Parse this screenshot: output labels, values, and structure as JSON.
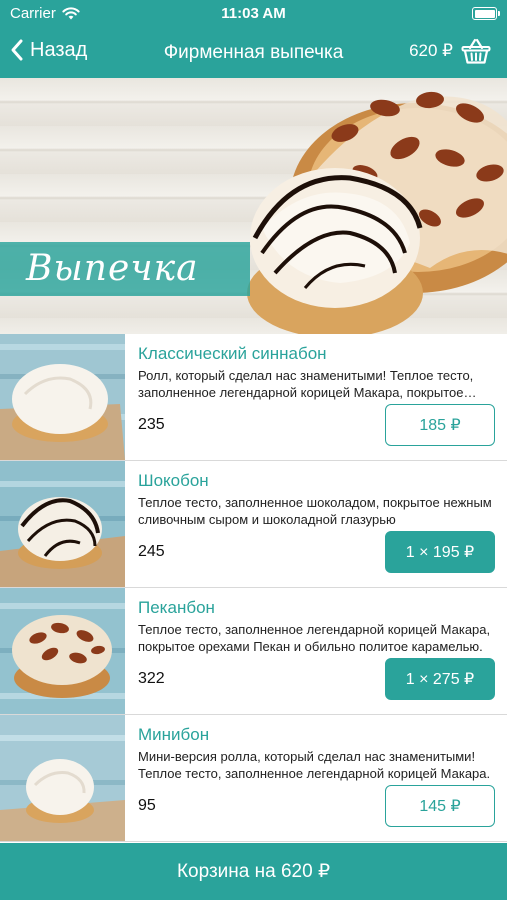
{
  "status_bar": {
    "carrier": "Carrier",
    "time": "11:03 AM"
  },
  "nav": {
    "back_label": "Назад",
    "title": "Фирменная выпечка",
    "cart_total": "620 ₽"
  },
  "banner": {
    "label": "Выпечка"
  },
  "products": [
    {
      "name": "Классический синнабон",
      "description": "Ролл, который сделал нас  знаменитыми! Теплое тесто, заполненное  легендарной корицей Макара, покрытое сливочным сыром.",
      "weight": "235",
      "price": "185 ₽",
      "in_cart": false
    },
    {
      "name": "Шокобон",
      "description": "Теплое тесто, заполненное шоколадом, покрытое нежным сливочным сыром и шоколадной глазурью",
      "weight": "245",
      "price": "1 × 195 ₽",
      "in_cart": true
    },
    {
      "name": "Пеканбон",
      "description": "Теплое тесто, заполненное легендарной корицей Макара, покрытое орехами Пекан и обильно политое карамелью.",
      "weight": "322",
      "price": "1 × 275 ₽",
      "in_cart": true
    },
    {
      "name": "Минибон",
      "description": "Мини-версия ролла, который сделал нас знаменитыми! Теплое тесто, заполненное  легендарной корицей Макара.",
      "weight": "95",
      "price": "145 ₽",
      "in_cart": false
    }
  ],
  "footer": {
    "cart_button": "Корзина на 620 ₽"
  },
  "colors": {
    "accent": "#2aa39b",
    "text": "#222222",
    "divider": "#d9d9d9"
  },
  "icons": {
    "wifi": "wifi-icon",
    "battery": "battery-icon",
    "back": "chevron-left-icon",
    "cart": "basket-icon"
  }
}
